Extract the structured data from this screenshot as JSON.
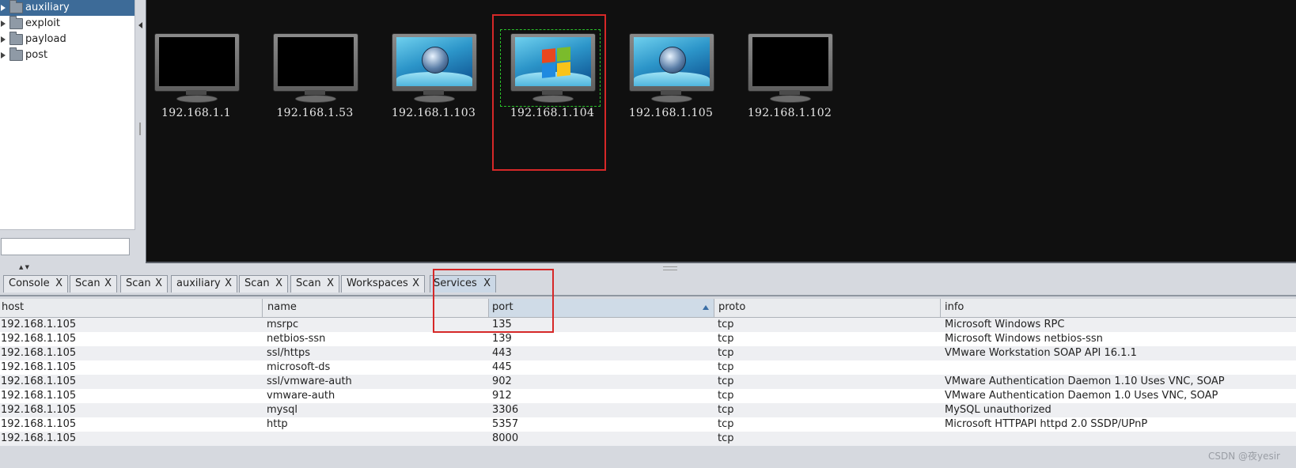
{
  "module_tree": {
    "items": [
      {
        "label": "auxiliary",
        "selected": true
      },
      {
        "label": "exploit",
        "selected": false
      },
      {
        "label": "payload",
        "selected": false
      },
      {
        "label": "post",
        "selected": false
      }
    ],
    "search_value": ""
  },
  "hosts": [
    {
      "ip": "192.168.1.1",
      "os": "unknown"
    },
    {
      "ip": "192.168.1.53",
      "os": "unknown"
    },
    {
      "ip": "192.168.1.103",
      "os": "windows-vista-orb"
    },
    {
      "ip": "192.168.1.104",
      "os": "windows-xp-flag"
    },
    {
      "ip": "192.168.1.105",
      "os": "windows-vista-orb"
    },
    {
      "ip": "192.168.1.102",
      "os": "unknown"
    }
  ],
  "tabs": [
    {
      "label": "Console"
    },
    {
      "label": "Scan"
    },
    {
      "label": "Scan"
    },
    {
      "label": "auxiliary"
    },
    {
      "label": "Scan"
    },
    {
      "label": "Scan"
    },
    {
      "label": "Workspaces"
    },
    {
      "label": "Services",
      "active": true
    }
  ],
  "tab_close": "X",
  "services_table": {
    "columns": [
      "host",
      "name",
      "port",
      "proto",
      "info"
    ],
    "sorted_column": "port",
    "rows": [
      [
        "192.168.1.105",
        "msrpc",
        "135",
        "tcp",
        "Microsoft Windows RPC"
      ],
      [
        "192.168.1.105",
        "netbios-ssn",
        "139",
        "tcp",
        "Microsoft Windows netbios-ssn"
      ],
      [
        "192.168.1.105",
        "ssl/https",
        "443",
        "tcp",
        "VMware Workstation SOAP API 16.1.1"
      ],
      [
        "192.168.1.105",
        "microsoft-ds",
        "445",
        "tcp",
        ""
      ],
      [
        "192.168.1.105",
        "ssl/vmware-auth",
        "902",
        "tcp",
        "VMware Authentication Daemon 1.10 Uses VNC, SOAP"
      ],
      [
        "192.168.1.105",
        "vmware-auth",
        "912",
        "tcp",
        "VMware Authentication Daemon 1.0 Uses VNC, SOAP"
      ],
      [
        "192.168.1.105",
        "mysql",
        "3306",
        "tcp",
        "MySQL unauthorized"
      ],
      [
        "192.168.1.105",
        "http",
        "5357",
        "tcp",
        "Microsoft HTTPAPI httpd 2.0 SSDP/UPnP"
      ],
      [
        "192.168.1.105",
        "",
        "8000",
        "tcp",
        ""
      ]
    ]
  },
  "credit": "CSDN @夜yesir",
  "colors": {
    "selection": "#3d6b98",
    "graph_bg": "#101010",
    "highlight": "#d62828",
    "focus": "#29c329"
  }
}
